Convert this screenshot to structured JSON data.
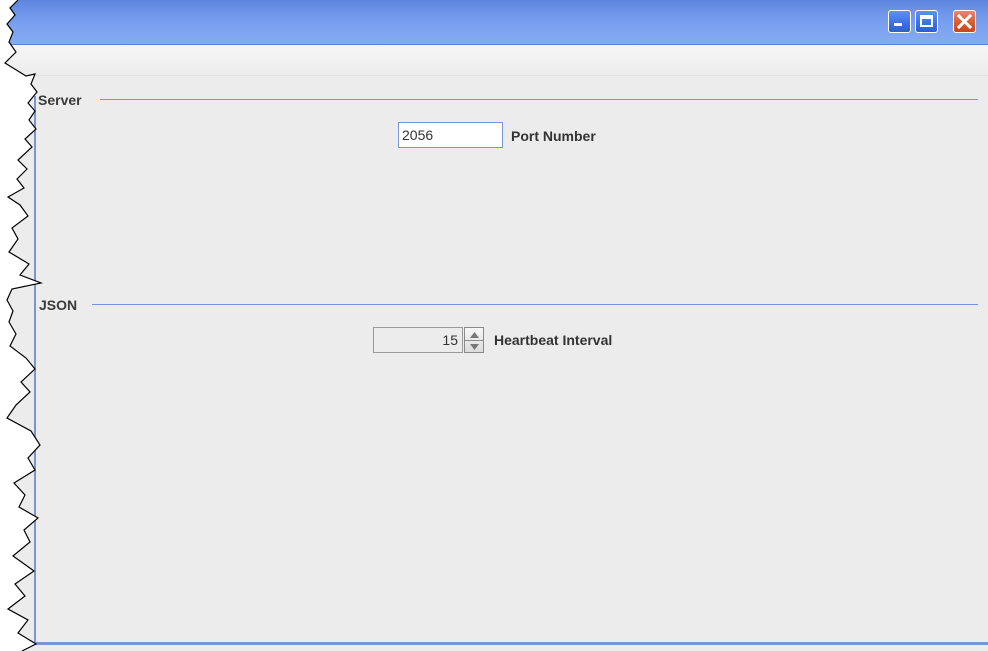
{
  "window": {
    "title": "",
    "minimize_icon": "minimize-icon",
    "maximize_icon": "maximize-icon",
    "close_icon": "close-icon"
  },
  "server_section": {
    "title": "Server",
    "port_number_label": "Port Number",
    "port_number_value": "2056"
  },
  "json_section": {
    "title": "JSON",
    "heartbeat_interval_label": "Heartbeat Interval",
    "heartbeat_interval_value": "15",
    "up_icon": "up-arrow-icon",
    "down_icon": "down-arrow-icon"
  },
  "colors": {
    "titlebar_blue": "#7aa1ef",
    "panel_gray": "#ececec",
    "group_line": "#7a96d2",
    "close_red": "#d95b35"
  }
}
